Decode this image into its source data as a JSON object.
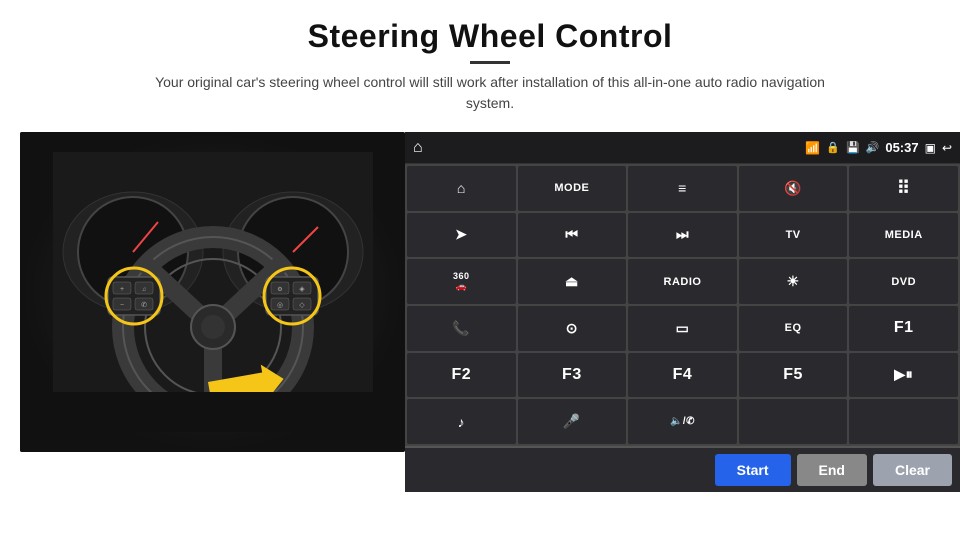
{
  "page": {
    "title": "Steering Wheel Control",
    "subtitle": "Your original car's steering wheel control will still work after installation of this all-in-one auto radio navigation system.",
    "divider": true
  },
  "status_bar": {
    "time": "05:37",
    "wifi_icon": "wifi",
    "lock_icon": "lock",
    "sd_icon": "sd",
    "bluetooth_icon": "bluetooth",
    "back_icon": "back",
    "home_icon": "home"
  },
  "buttons": [
    {
      "id": "nav",
      "label": "⌂",
      "type": "icon"
    },
    {
      "id": "mode",
      "label": "MODE",
      "type": "text"
    },
    {
      "id": "list",
      "label": "≡",
      "type": "icon"
    },
    {
      "id": "mute",
      "label": "🔇",
      "type": "icon"
    },
    {
      "id": "apps",
      "label": "⠿",
      "type": "icon"
    },
    {
      "id": "send",
      "label": "➤",
      "type": "icon"
    },
    {
      "id": "prev",
      "label": "⏮",
      "type": "icon"
    },
    {
      "id": "next",
      "label": "⏭",
      "type": "icon"
    },
    {
      "id": "tv",
      "label": "TV",
      "type": "text"
    },
    {
      "id": "media",
      "label": "MEDIA",
      "type": "text"
    },
    {
      "id": "cam360",
      "label": "360",
      "type": "icon"
    },
    {
      "id": "eject",
      "label": "⏏",
      "type": "icon"
    },
    {
      "id": "radio",
      "label": "RADIO",
      "type": "text"
    },
    {
      "id": "bright",
      "label": "☀",
      "type": "icon"
    },
    {
      "id": "dvd",
      "label": "DVD",
      "type": "text"
    },
    {
      "id": "phone",
      "label": "📞",
      "type": "icon"
    },
    {
      "id": "nav2",
      "label": "⊙",
      "type": "icon"
    },
    {
      "id": "rect",
      "label": "▭",
      "type": "icon"
    },
    {
      "id": "eq",
      "label": "EQ",
      "type": "text"
    },
    {
      "id": "f1",
      "label": "F1",
      "type": "text"
    },
    {
      "id": "f2",
      "label": "F2",
      "type": "text"
    },
    {
      "id": "f3",
      "label": "F3",
      "type": "text"
    },
    {
      "id": "f4",
      "label": "F4",
      "type": "text"
    },
    {
      "id": "f5",
      "label": "F5",
      "type": "text"
    },
    {
      "id": "playpause",
      "label": "▶⏸",
      "type": "icon"
    },
    {
      "id": "music",
      "label": "♪",
      "type": "icon"
    },
    {
      "id": "mic",
      "label": "🎤",
      "type": "icon"
    },
    {
      "id": "volphone",
      "label": "🔈/✆",
      "type": "icon"
    },
    {
      "id": "empty1",
      "label": "",
      "type": "empty"
    },
    {
      "id": "empty2",
      "label": "",
      "type": "empty"
    }
  ],
  "action_buttons": {
    "start": "Start",
    "end": "End",
    "clear": "Clear"
  }
}
